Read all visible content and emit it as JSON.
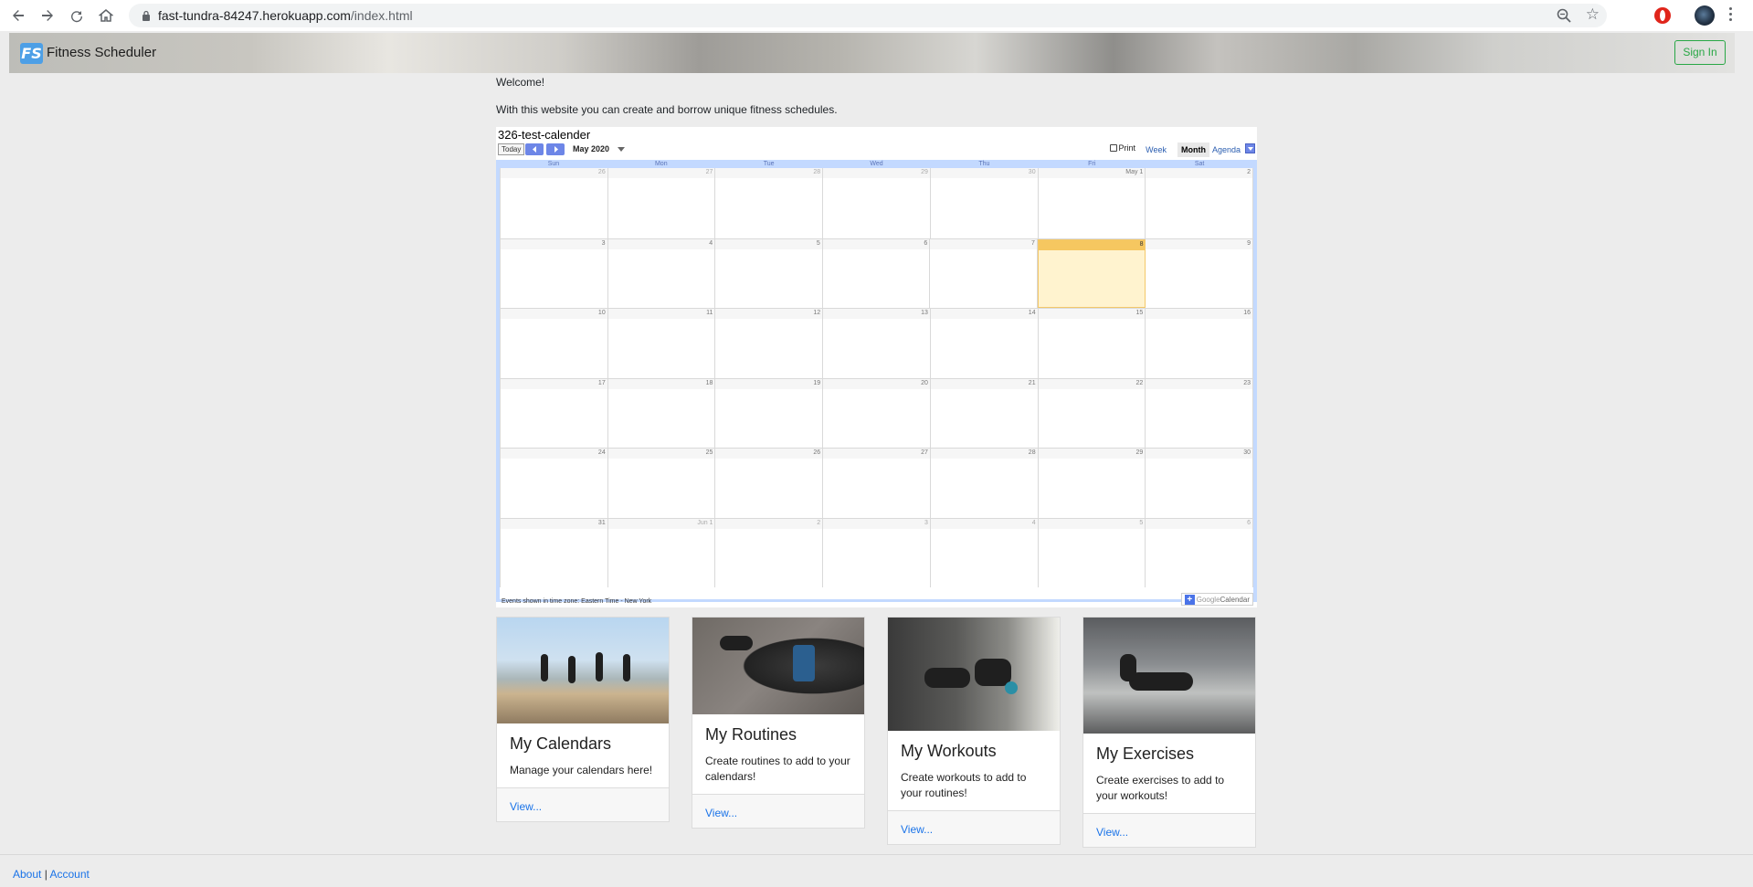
{
  "browser": {
    "url_host": "fast-tundra-84247.herokuapp.com",
    "url_path": "/index.html"
  },
  "navbar": {
    "logo_text": "FS",
    "brand": "Fitness Scheduler",
    "signin_label": "Sign In"
  },
  "intro": {
    "welcome": "Welcome!",
    "description": "With this website you can create and borrow unique fitness schedules."
  },
  "calendar": {
    "title": "326-test-calender",
    "today_label": "Today",
    "month_label": "May 2020",
    "print_label": "Print",
    "views": [
      "Week",
      "Month",
      "Agenda"
    ],
    "active_view": "Month",
    "weekdays": [
      "Sun",
      "Mon",
      "Tue",
      "Wed",
      "Thu",
      "Fri",
      "Sat"
    ],
    "weeks": [
      [
        "26",
        "27",
        "28",
        "29",
        "30",
        "May 1",
        "2"
      ],
      [
        "3",
        "4",
        "5",
        "6",
        "7",
        "8",
        "9"
      ],
      [
        "10",
        "11",
        "12",
        "13",
        "14",
        "15",
        "16"
      ],
      [
        "17",
        "18",
        "19",
        "20",
        "21",
        "22",
        "23"
      ],
      [
        "24",
        "25",
        "26",
        "27",
        "28",
        "29",
        "30"
      ],
      [
        "31",
        "Jun 1",
        "2",
        "3",
        "4",
        "5",
        "6"
      ]
    ],
    "timezone_note": "Events shown in time zone: Eastern Time - New York",
    "badge_google": "Google",
    "badge_calendar": "Calendar"
  },
  "cards": [
    {
      "title": "My Calendars",
      "text": "Manage your calendars here!",
      "link": "View..."
    },
    {
      "title": "My Routines",
      "text": "Create routines to add to your calendars!",
      "link": "View..."
    },
    {
      "title": "My Workouts",
      "text": "Create workouts to add to your routines!",
      "link": "View..."
    },
    {
      "title": "My Exercises",
      "text": "Create exercises to add to your workouts!",
      "link": "View..."
    }
  ],
  "footer": {
    "about": "About",
    "separator": "|",
    "account": "Account"
  }
}
